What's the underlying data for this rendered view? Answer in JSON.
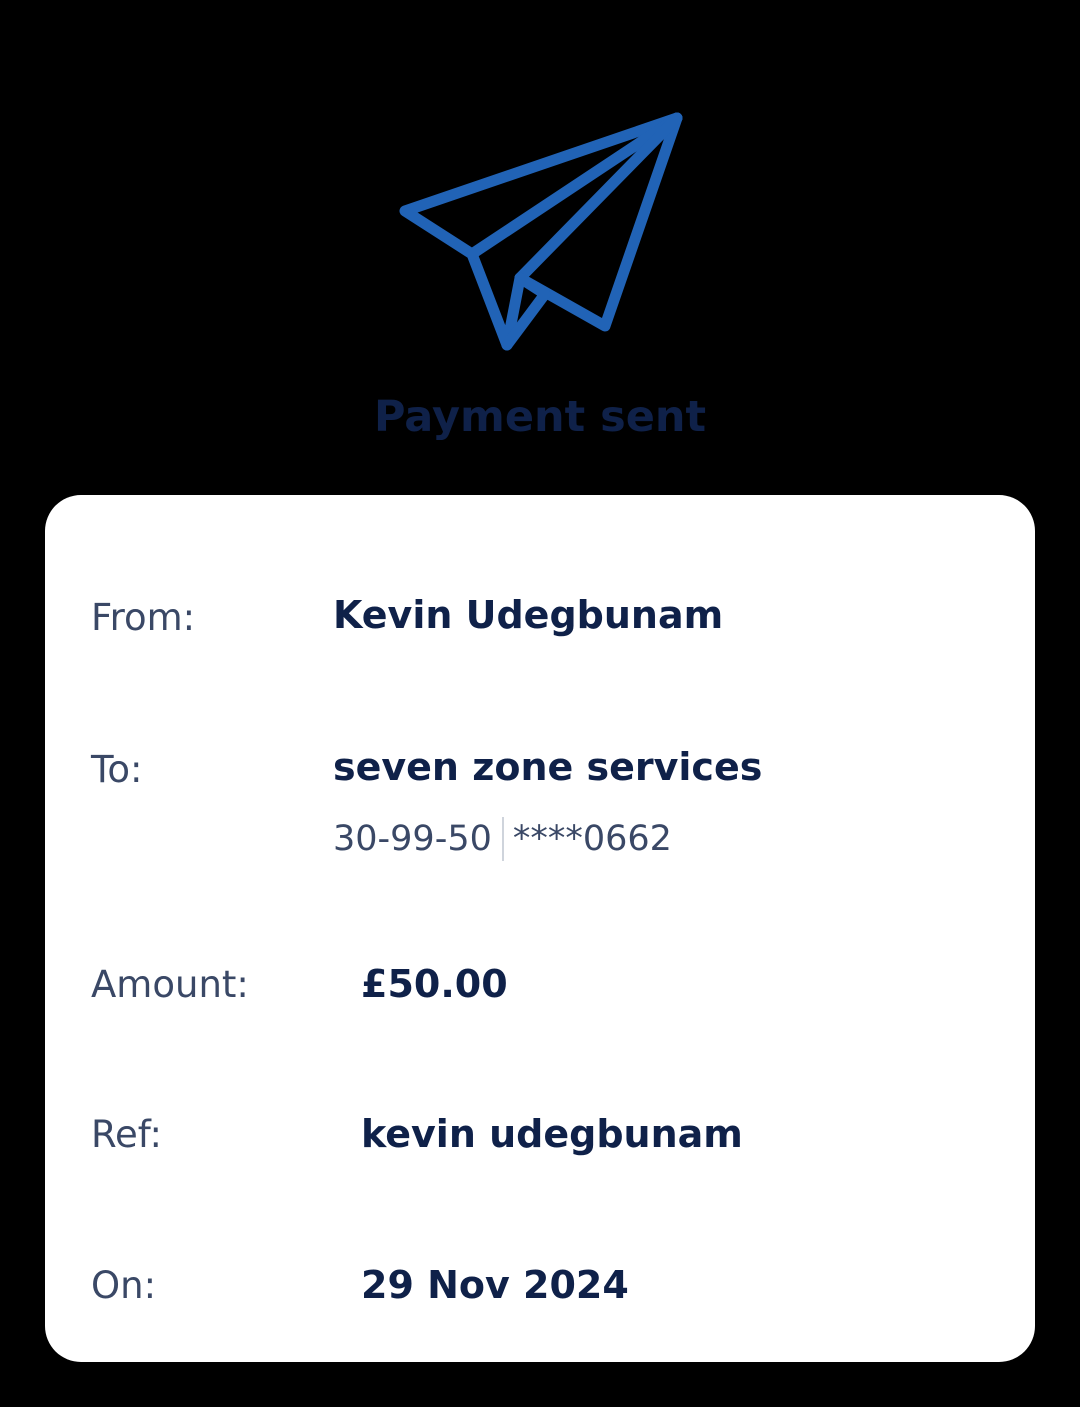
{
  "header": {
    "icon": "paper-plane-icon",
    "title": "Payment sent"
  },
  "details": {
    "from": {
      "label": "From:",
      "value": "Kevin Udegbunam"
    },
    "to": {
      "label": "To:",
      "value": "seven zone services",
      "sort_code": "30-99-50",
      "account": "****0662"
    },
    "amount": {
      "label": "Amount:",
      "value": "£50.00"
    },
    "ref": {
      "label": "Ref:",
      "value": "kevin udegbunam"
    },
    "on": {
      "label": "On:",
      "value": "29 Nov 2024"
    }
  },
  "colors": {
    "background": "#000000",
    "icon_blue": "#2163b6",
    "title_navy": "#0f2149",
    "card": "#ffffff",
    "label_gray": "#3a4866"
  }
}
